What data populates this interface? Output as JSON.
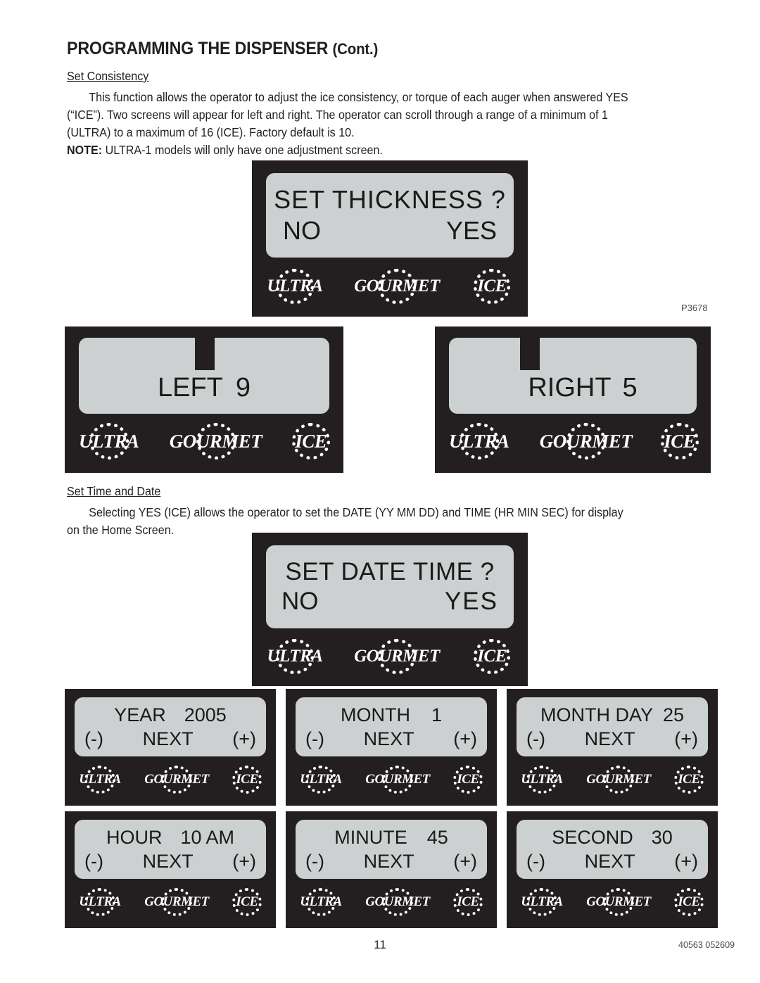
{
  "header": {
    "title": "PROGRAMMING THE DISPENSER",
    "title_suffix": "(Cont.)"
  },
  "sections": [
    {
      "heading": "Set Consistency",
      "body_line1": "This function allows the operator to adjust the ice consistency, or torque of each auger when answered YES",
      "body_line2": "(“ICE”). Two screens will appear for left and right. The operator can scroll through a range of a minimum of 1",
      "body_line3": "(ULTRA) to a maximum of 16 (ICE). Factory default is 10.",
      "note_label": "NOTE:",
      "note_text": " ULTRA-1 models will only have one adjustment screen."
    },
    {
      "heading": "Set Time and Date",
      "body_line1": "Selecting YES (ICE) allows the operator to set the DATE (YY MM DD) and TIME (HR MIN SEC) for display",
      "body_line2": "on the Home Screen."
    }
  ],
  "logo": {
    "ultra": "ULTRA",
    "gourmet": "GOURMET",
    "ice": "ICE"
  },
  "screens": {
    "set_thickness": {
      "line1": "SET  THICKNESS  ?",
      "line2_left": "NO",
      "line2_right": "YES"
    },
    "left_consistency": {
      "label": "LEFT",
      "value": "9"
    },
    "right_consistency": {
      "label": "RIGHT",
      "value": "5"
    },
    "set_date_time": {
      "line1": "SET DATE TIME ?",
      "line2_left": "NO",
      "line2_right": "YES"
    },
    "year": {
      "label": "YEAR",
      "value": "2005"
    },
    "month": {
      "label": "MONTH",
      "value": "1"
    },
    "month_day": {
      "label": "MONTH DAY",
      "value": "25"
    },
    "hour": {
      "label": "HOUR",
      "value": "10 AM"
    },
    "minute": {
      "label": "MINUTE",
      "value": "45"
    },
    "second": {
      "label": "SECOND",
      "value": "30"
    },
    "nav": {
      "minus": "(-)",
      "next": "NEXT",
      "plus": "(+)"
    }
  },
  "figure_reference": "P3678",
  "footer": {
    "page_number": "11",
    "doc_code": "40563 052609"
  },
  "colors": {
    "bezel": "#231f20",
    "lcd": "#cdd0d1",
    "text": "#231f20"
  }
}
